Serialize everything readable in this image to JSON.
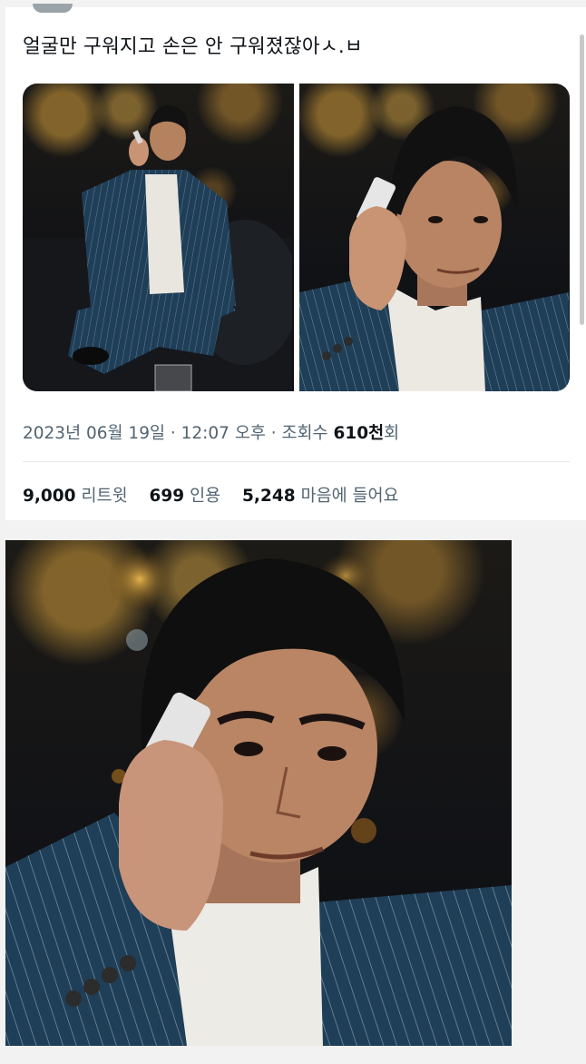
{
  "tweet": {
    "text": "얼굴만 구워지고 손은 안 구워졌잖아ㅅ.ㅂ",
    "timestamp": "2023년 06월 19일 · 12:07 오후 · 조회수",
    "views_value": "610천",
    "views_suffix": "회",
    "stats": [
      {
        "value": "9,000",
        "label": "리트윗"
      },
      {
        "value": "699",
        "label": "인용"
      },
      {
        "value": "5,248",
        "label": "마음에 들어요"
      }
    ]
  },
  "colors": {
    "text": "#0f1419",
    "muted": "#536471",
    "suit": "#1f3e57",
    "background": "#f2f2f3"
  },
  "icons": [
    "avatar",
    "photo"
  ]
}
